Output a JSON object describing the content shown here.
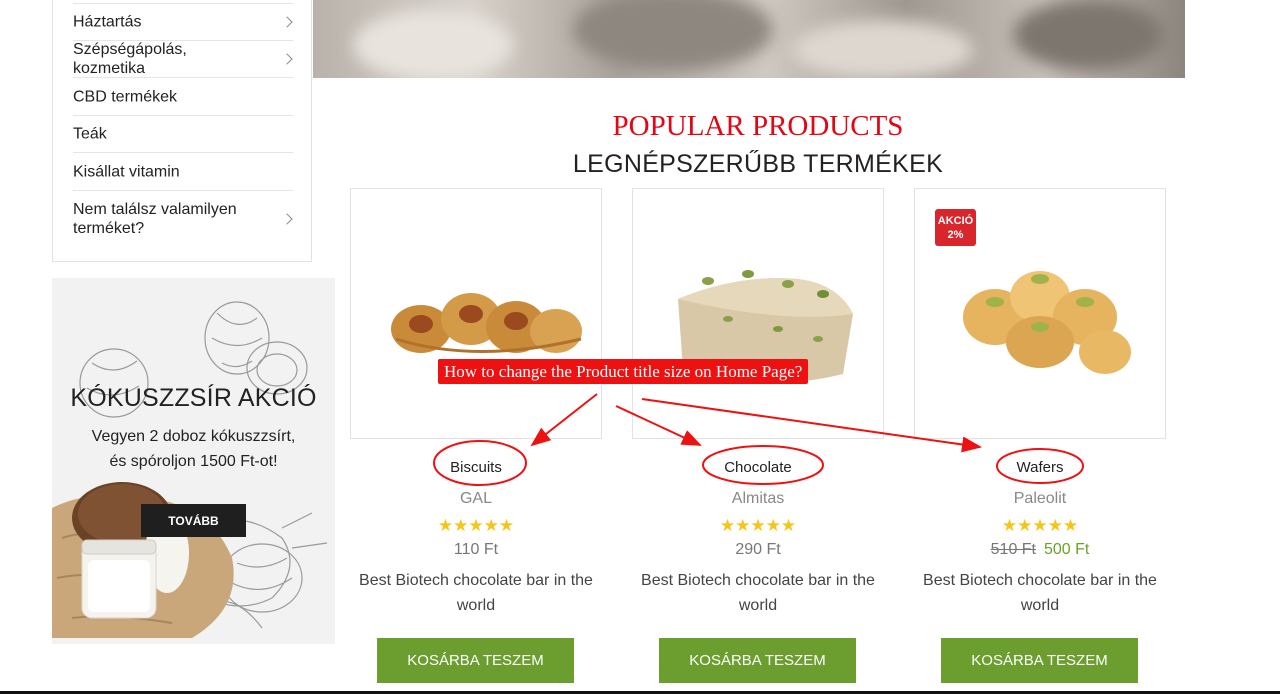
{
  "sidebar": {
    "items": [
      {
        "label": "Háztartás",
        "has_submenu": true
      },
      {
        "label": "Szépségápolás, kozmetika",
        "has_submenu": true
      },
      {
        "label": "CBD termékek",
        "has_submenu": false
      },
      {
        "label": "Teák",
        "has_submenu": false
      },
      {
        "label": "Kisállat vitamin",
        "has_submenu": false
      },
      {
        "label": "Nem találsz valamilyen terméket?",
        "has_submenu": true
      }
    ]
  },
  "promo": {
    "title": "KÓKUSZZSÍR AKCIÓ",
    "text_line1": "Vegyen 2 doboz kókuszzsírt,",
    "text_line2": "és spóroljon 1500 Ft-ot!",
    "button": "TOVÁBB"
  },
  "section": {
    "title_en": "POPULAR PRODUCTS",
    "title_hu": "LEGNÉPSZERŰBB TERMÉKEK"
  },
  "annotation": {
    "text": "How to change the Product title size on Home Page?",
    "color": "#e11111"
  },
  "products": [
    {
      "title": "Biscuits",
      "brand": "GAL",
      "rating": 5,
      "stars": "★★★★★",
      "price": "110 Ft",
      "old_price": "",
      "description": "Best Biotech chocolate bar in the world",
      "cart": "KOSÁRBA TESZEM",
      "badge": ""
    },
    {
      "title": "Chocolate",
      "brand": "Almitas",
      "rating": 5,
      "stars": "★★★★★",
      "price": "290 Ft",
      "old_price": "",
      "description": "Best Biotech chocolate bar in the world",
      "cart": "KOSÁRBA TESZEM",
      "badge": ""
    },
    {
      "title": "Wafers",
      "brand": "Paleolit",
      "rating": 5,
      "stars": "★★★★★",
      "price": "500 Ft",
      "old_price": "510 Ft",
      "description": "Best Biotech chocolate bar in the world",
      "cart": "KOSÁRBA TESZEM",
      "badge_line1": "AKCIÓ",
      "badge_line2": "2%"
    }
  ],
  "colors": {
    "accent_red": "#e30613",
    "cart_green": "#6b9e2f",
    "sale_price_green": "#6aa12b",
    "star_yellow": "#f5c518",
    "badge_red": "#d9262c"
  },
  "icons": [
    "chevron-right-icon",
    "star-icon"
  ]
}
